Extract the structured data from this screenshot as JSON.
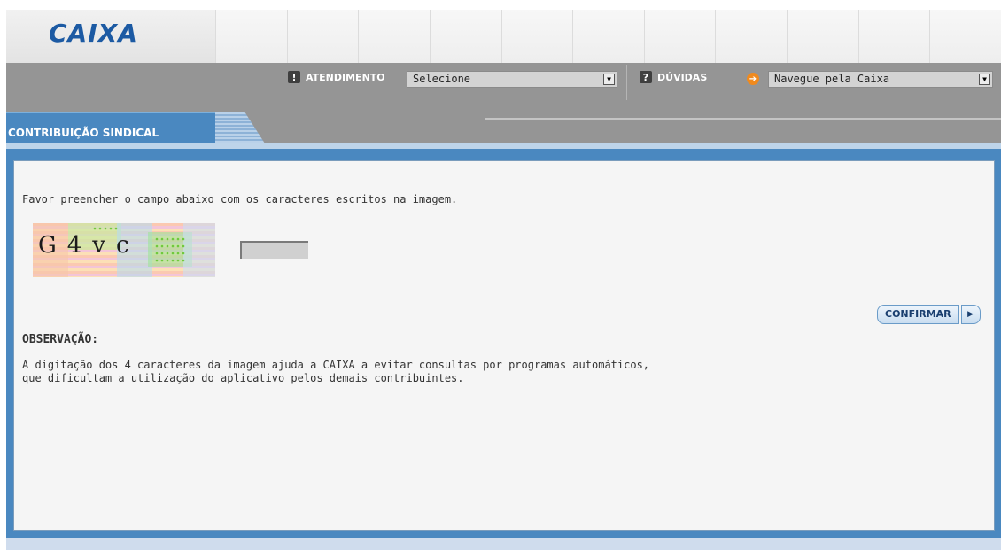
{
  "header": {
    "logo": "CAIXA",
    "nav": {
      "atendimento_label": "ATENDIMENTO",
      "atendimento_select": "Selecione",
      "duvidas_label": "DÚVIDAS",
      "navegue_select": "Navegue pela Caixa"
    }
  },
  "tab": {
    "label": "CONTRIBUIÇÃO SINDICAL"
  },
  "main": {
    "instruction": "Favor preencher o campo abaixo com os caracteres escritos na imagem.",
    "captcha_text": "G4vc",
    "captcha_input_value": "",
    "confirm_label": "CONFIRMAR",
    "observation_title": "OBSERVAÇÃO:",
    "observation_text": "A digitação dos 4 caracteres da imagem ajuda a CAIXA a evitar consultas por programas automáticos,\nque dificultam a utilização do aplicativo pelos demais contribuintes."
  },
  "icons": {
    "atendimento": "exclamation-icon",
    "duvidas": "question-icon",
    "navegue": "arrow-right-icon"
  },
  "colors": {
    "brand_blue": "#1c5aa3",
    "nav_gray": "#959595",
    "tab_blue": "#4a88c0",
    "accent_orange": "#f08a1e"
  }
}
